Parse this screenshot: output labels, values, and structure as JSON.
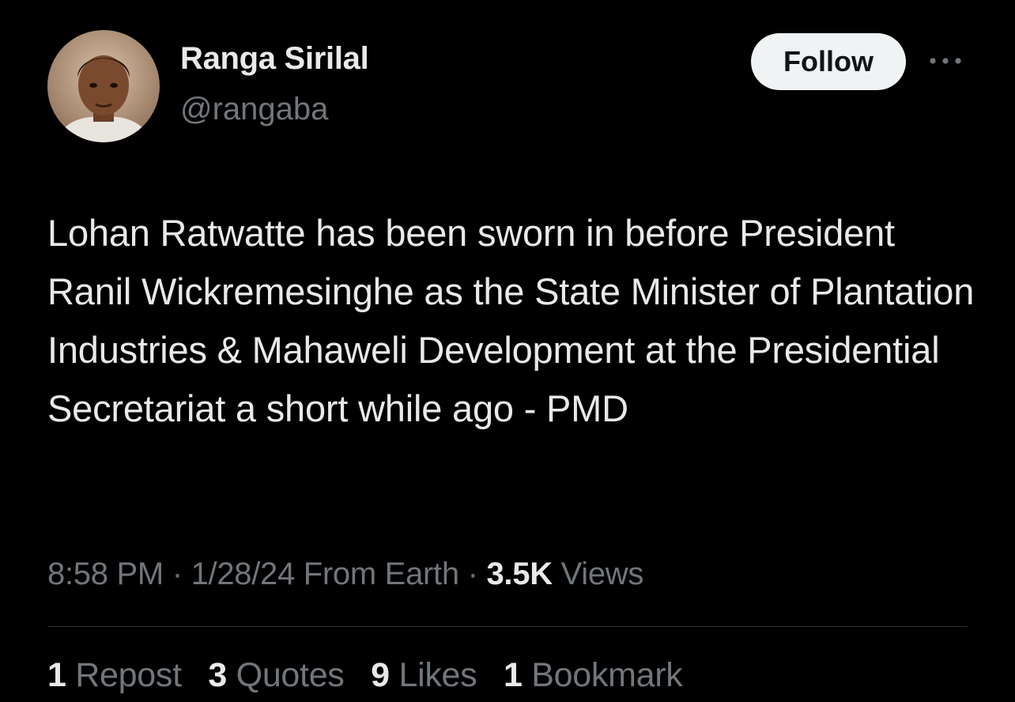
{
  "author": {
    "display_name": "Ranga Sirilal",
    "handle": "@rangaba",
    "avatar_icon": "profile-photo"
  },
  "follow_button": {
    "label": "Follow"
  },
  "more_icon": "more-horizontal-icon",
  "tweet": {
    "text": "Lohan Ratwatte has been sworn in before President Ranil Wickremesinghe as the State Minister of Plantation Industries & Mahaweli Development at the Presidential Secretariat a short while ago - PMD"
  },
  "meta": {
    "time": "8:58 PM",
    "separator1": "·",
    "date": "1/28/24",
    "source": "From Earth",
    "separator2": "·",
    "views_count": "3.5K",
    "views_label": "Views"
  },
  "stats": {
    "reposts_count": "1",
    "reposts_label": "Repost",
    "quotes_count": "3",
    "quotes_label": "Quotes",
    "likes_count": "9",
    "likes_label": "Likes",
    "bookmarks_count": "1",
    "bookmarks_label": "Bookmark"
  },
  "colors": {
    "background": "#000000",
    "primary_text": "#e7e9ea",
    "secondary_text": "#71767b",
    "button_bg": "#eff3f4",
    "divider": "#2f3336"
  }
}
